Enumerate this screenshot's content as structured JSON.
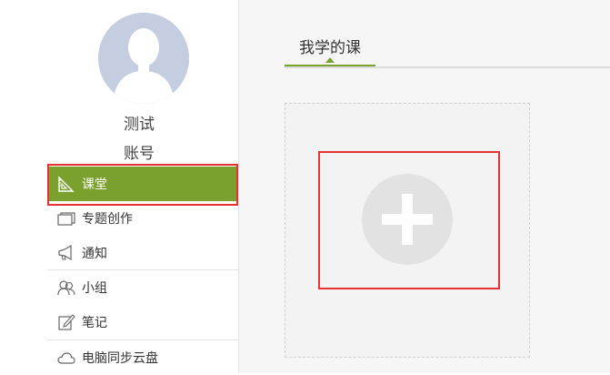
{
  "user": {
    "name_line1": "测试",
    "name_line2": "账号"
  },
  "nav": {
    "items": [
      {
        "label": "课堂",
        "icon": "classroom-icon",
        "active": true
      },
      {
        "label": "专题创作",
        "icon": "topic-icon",
        "active": false
      },
      {
        "label": "通知",
        "icon": "megaphone-icon",
        "active": false
      },
      {
        "label": "小组",
        "icon": "group-icon",
        "active": false
      },
      {
        "label": "笔记",
        "icon": "note-icon",
        "active": false
      },
      {
        "label": "电脑同步云盘",
        "icon": "cloud-icon",
        "active": false
      }
    ]
  },
  "main": {
    "tabs": [
      {
        "label": "我学的课",
        "active": true
      }
    ],
    "add_card_icon": "plus-icon"
  },
  "colors": {
    "accent": "#7aa02e",
    "highlight_border": "#e53333",
    "avatar_bg": "#c5cee0"
  }
}
